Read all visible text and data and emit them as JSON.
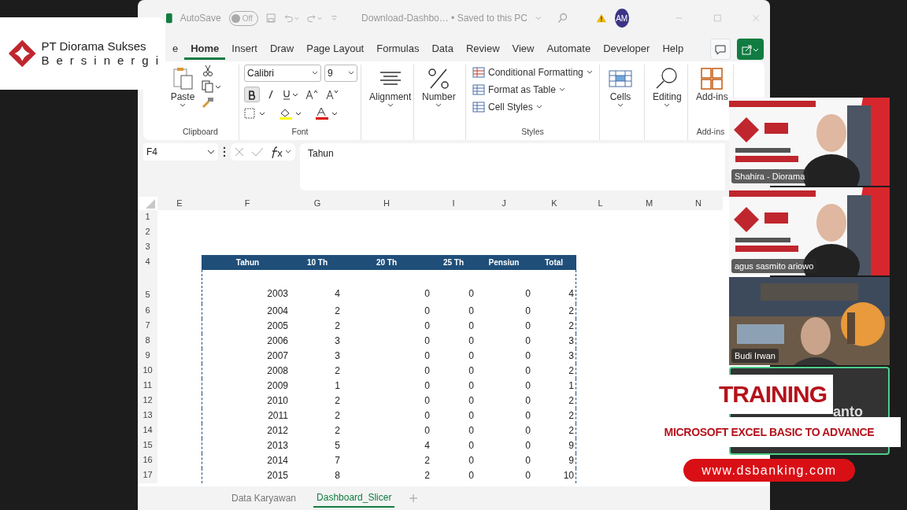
{
  "title_bar": {
    "autosave_label": "AutoSave",
    "autosave_on": false,
    "autosave_state": "Off",
    "document_title": "Download-Dashbo…  •  Saved to this PC",
    "avatar": "AM"
  },
  "ribbon_tabs": [
    {
      "label": "e",
      "selected": false
    },
    {
      "label": "Home",
      "selected": true
    },
    {
      "label": "Insert",
      "selected": false
    },
    {
      "label": "Draw",
      "selected": false
    },
    {
      "label": "Page Layout",
      "selected": false
    },
    {
      "label": "Formulas",
      "selected": false
    },
    {
      "label": "Data",
      "selected": false
    },
    {
      "label": "Review",
      "selected": false
    },
    {
      "label": "View",
      "selected": false
    },
    {
      "label": "Automate",
      "selected": false
    },
    {
      "label": "Developer",
      "selected": false
    },
    {
      "label": "Help",
      "selected": false
    }
  ],
  "ribbon": {
    "clipboard": {
      "paste": "Paste",
      "label": "Clipboard"
    },
    "font": {
      "name": "Calibri",
      "size": "9",
      "bold": true,
      "label": "Font"
    },
    "alignment": "Alignment",
    "number": "Number",
    "styles": {
      "items": [
        "Conditional Formatting",
        "Format as Table",
        "Cell Styles"
      ],
      "label": "Styles"
    },
    "cells": "Cells",
    "editing": "Editing",
    "addins": {
      "button": "Add-ins",
      "label": "Add-ins"
    }
  },
  "formula_bar": {
    "name_box": "F4",
    "formula": "Tahun"
  },
  "grid": {
    "columns": [
      "E",
      "F",
      "G",
      "H",
      "I",
      "J",
      "K",
      "L",
      "M",
      "N"
    ],
    "row_numbers": [
      "1",
      "2",
      "3",
      "4",
      "5",
      "6",
      "7",
      "8",
      "9",
      "10",
      "11",
      "12",
      "13",
      "14",
      "15",
      "16",
      "17"
    ],
    "table": {
      "header": [
        "Tahun",
        "10 Th",
        "20 Th",
        "25 Th",
        "Pensiun",
        "Total"
      ],
      "rows": [
        [
          "2003",
          "4",
          "0",
          "0",
          "0",
          "4"
        ],
        [
          "2004",
          "2",
          "0",
          "0",
          "0",
          "2"
        ],
        [
          "2005",
          "2",
          "0",
          "0",
          "0",
          "2"
        ],
        [
          "2006",
          "3",
          "0",
          "0",
          "0",
          "3"
        ],
        [
          "2007",
          "3",
          "0",
          "0",
          "0",
          "3"
        ],
        [
          "2008",
          "2",
          "0",
          "0",
          "0",
          "2"
        ],
        [
          "2009",
          "1",
          "0",
          "0",
          "0",
          "1"
        ],
        [
          "2010",
          "2",
          "0",
          "0",
          "0",
          "2"
        ],
        [
          "2011",
          "2",
          "0",
          "0",
          "0",
          "2"
        ],
        [
          "2012",
          "2",
          "0",
          "0",
          "0",
          "2"
        ],
        [
          "2013",
          "5",
          "4",
          "0",
          "0",
          "9"
        ],
        [
          "2014",
          "7",
          "2",
          "0",
          "0",
          "9"
        ],
        [
          "2015",
          "8",
          "2",
          "0",
          "0",
          "10"
        ]
      ]
    }
  },
  "sheet_tabs": [
    {
      "label": "Data Karyawan",
      "selected": false
    },
    {
      "label": "Dashboard_Slicer",
      "selected": true
    }
  ],
  "company_logo": {
    "line1": "PT Diorama  Sukses",
    "line2": "Bersinergi"
  },
  "participants": [
    {
      "name": "Shahira - Diorama",
      "kind": "banner",
      "speaking": false
    },
    {
      "name": "agus sasmito ariowo",
      "kind": "banner",
      "speaking": false
    },
    {
      "name": "Budi Irwan",
      "kind": "poster",
      "speaking": false
    },
    {
      "name": "anto",
      "kind": "no-video",
      "speaking": true
    }
  ],
  "banner": {
    "title": "TRAINING",
    "subtitle": "MICROSOFT EXCEL BASIC TO ADVANCE",
    "website": "www.dsbanking.com"
  }
}
